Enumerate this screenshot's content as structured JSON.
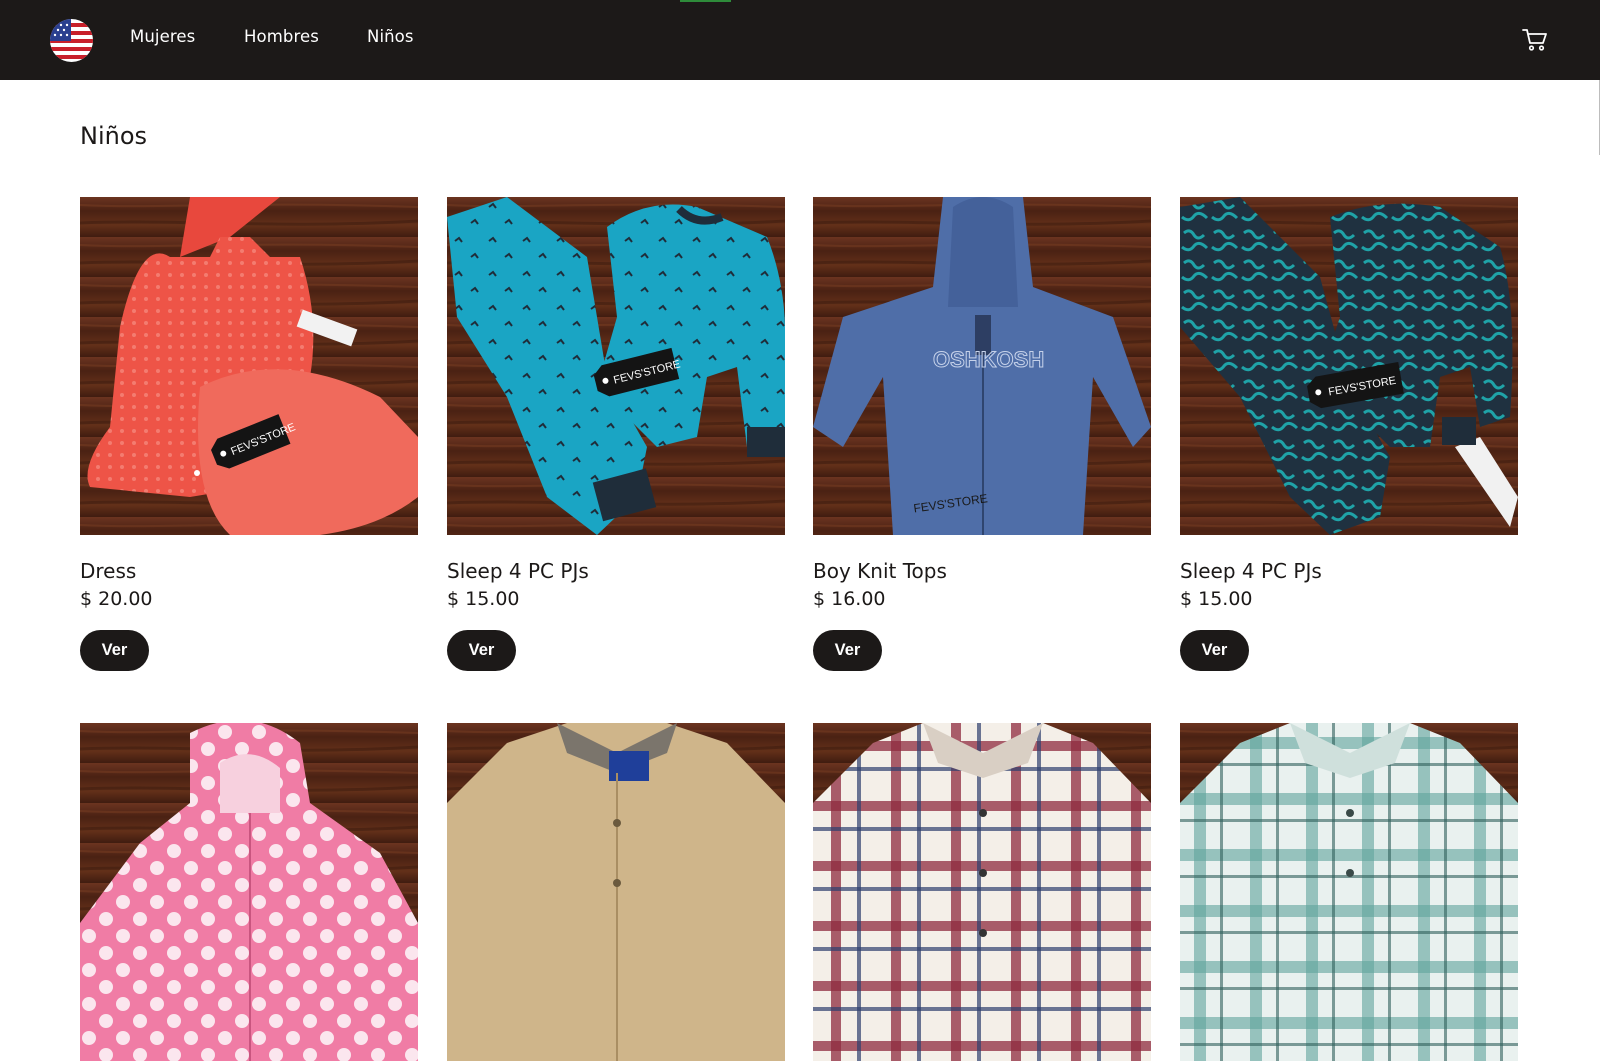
{
  "nav": {
    "logo_icon": "us-flag-icon",
    "links": [
      {
        "label": "Mujeres"
      },
      {
        "label": "Hombres"
      },
      {
        "label": "Niños"
      }
    ],
    "cart_icon": "shopping-cart-icon"
  },
  "page": {
    "title": "Niños"
  },
  "products": [
    {
      "name": "Dress",
      "price": "$ 20.00",
      "button": "Ver",
      "image": "red-ruffle-dress-photo",
      "tag": "FEVS'STORE"
    },
    {
      "name": "Sleep 4 PC PJs",
      "price": "$ 15.00",
      "button": "Ver",
      "image": "teal-pajama-set-photo",
      "tag": "FEVS'STORE"
    },
    {
      "name": "Boy Knit Tops",
      "price": "$ 16.00",
      "button": "Ver",
      "image": "blue-hoodie-photo",
      "tag": "FEVS'STORE",
      "print": "OSHKOSH"
    },
    {
      "name": "Sleep 4 PC PJs",
      "price": "$ 15.00",
      "button": "Ver",
      "image": "navy-floral-pajama-photo",
      "tag": "FEVS'STORE"
    },
    {
      "name": "",
      "price": "",
      "button": "",
      "image": "pink-polka-dot-jacket-photo"
    },
    {
      "name": "",
      "price": "",
      "button": "",
      "image": "tan-button-jacket-photo"
    },
    {
      "name": "",
      "price": "",
      "button": "",
      "image": "red-plaid-shirt-photo"
    },
    {
      "name": "",
      "price": "",
      "button": "",
      "image": "teal-plaid-shirt-photo"
    }
  ],
  "colors": {
    "nav_background": "#1c1918",
    "button_background": "#1c1918",
    "loading_bar": "#2e8b3a",
    "wood": "#5a2a18"
  }
}
